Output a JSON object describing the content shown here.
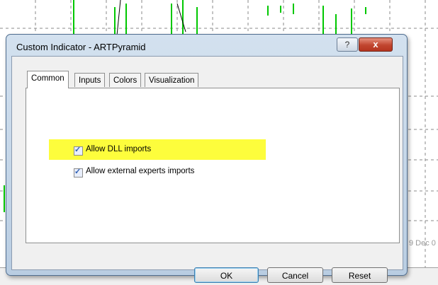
{
  "dialog": {
    "title": "Custom Indicator - ARTPyramid",
    "help_label": "?",
    "close_label": "x",
    "tabs": [
      {
        "label": "Common",
        "active": true
      },
      {
        "label": "Inputs",
        "active": false
      },
      {
        "label": "Colors",
        "active": false
      },
      {
        "label": "Visualization",
        "active": false
      }
    ],
    "options": [
      {
        "label": "Allow DLL imports",
        "checked": true,
        "highlighted": true
      },
      {
        "label": "Allow external experts imports",
        "checked": true,
        "highlighted": false
      }
    ],
    "buttons": {
      "ok": "OK",
      "cancel": "Cancel",
      "reset": "Reset"
    }
  },
  "background": {
    "date_label": "9 Dec 0",
    "colors": {
      "candle": "#00c800",
      "grid": "#8a8a8a",
      "highlight": "#fdfd3c"
    }
  }
}
